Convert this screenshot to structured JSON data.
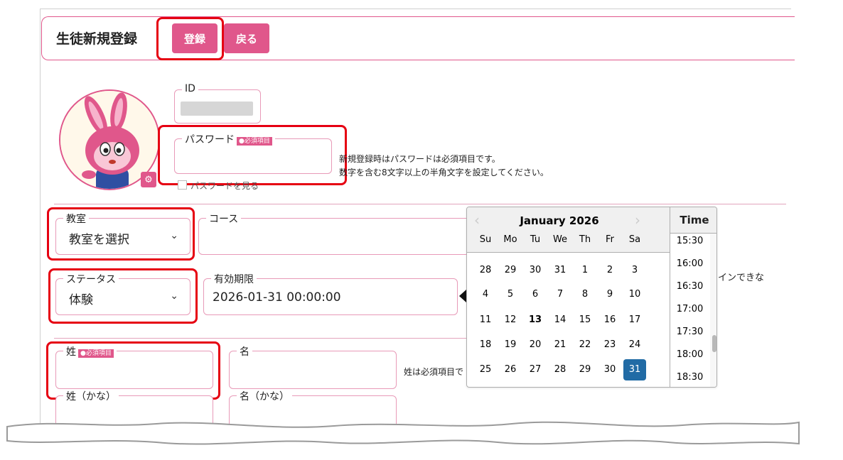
{
  "header": {
    "title": "生徒新規登録",
    "register_label": "登録",
    "back_label": "戻る"
  },
  "account": {
    "id_label": "ID",
    "password_label": "パスワード",
    "required_badge": "●必須項目",
    "password_note_line1": "新規登録時はパスワードは必須項目です。",
    "password_note_line2": "数字を含む8文字以上の半角文字を設定してください。",
    "show_password_label": "パスワードを見る"
  },
  "form": {
    "classroom_label": "教室",
    "classroom_value": "教室を選択",
    "course_label": "コース",
    "status_label": "ステータス",
    "status_value": "体験",
    "expiry_label": "有効期限",
    "expiry_value": "2026-01-31 00:00:00",
    "login_note_fragment": "インできな",
    "last_name_label": "姓",
    "first_name_label": "名",
    "last_name_note": "姓は必須項目で",
    "last_name_kana_label": "姓（かな）",
    "first_name_kana_label": "名（かな）"
  },
  "datepicker": {
    "month_label": "January 2026",
    "weekdays": [
      "Su",
      "Mo",
      "Tu",
      "We",
      "Th",
      "Fr",
      "Sa"
    ],
    "weeks": [
      [
        "28",
        "29",
        "30",
        "31",
        "1",
        "2",
        "3"
      ],
      [
        "4",
        "5",
        "6",
        "7",
        "8",
        "9",
        "10"
      ],
      [
        "11",
        "12",
        "13",
        "14",
        "15",
        "16",
        "17"
      ],
      [
        "18",
        "19",
        "20",
        "21",
        "22",
        "23",
        "24"
      ],
      [
        "25",
        "26",
        "27",
        "28",
        "29",
        "30",
        "31"
      ]
    ],
    "today": "13",
    "selected": "31",
    "time_title": "Time",
    "times": [
      "15:30",
      "16:00",
      "16:30",
      "17:00",
      "17:30",
      "18:00",
      "18:30"
    ]
  },
  "colors": {
    "brand_pink": "#e0578b",
    "highlight_red": "#e60012",
    "selected_day_blue": "#216ba5"
  }
}
